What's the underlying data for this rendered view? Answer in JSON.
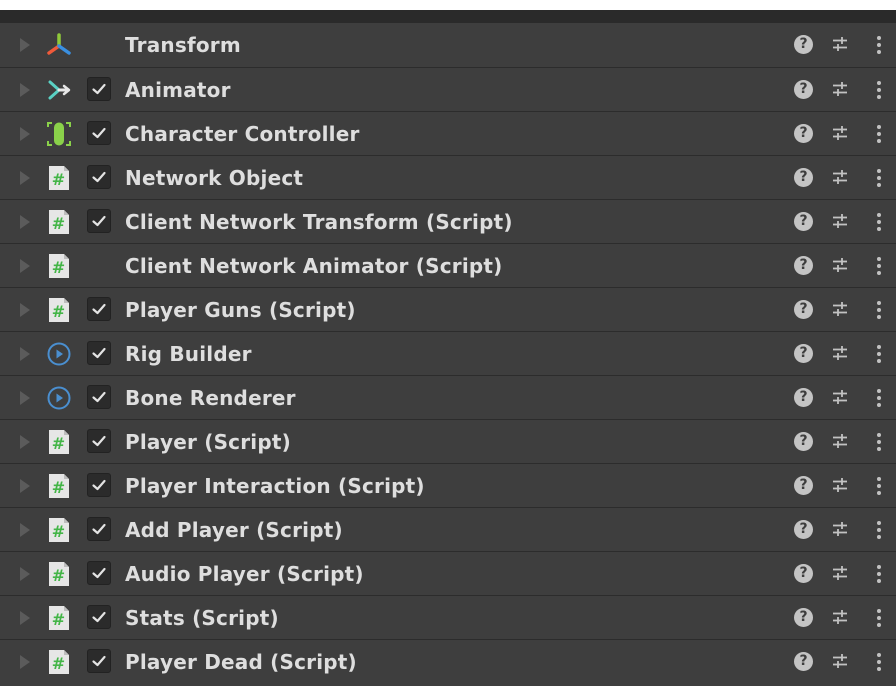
{
  "components": [
    {
      "name": "Transform",
      "icon": "transform-icon",
      "has_toggle": false
    },
    {
      "name": "Animator",
      "icon": "animator-icon",
      "has_toggle": true
    },
    {
      "name": "Character Controller",
      "icon": "character-controller-icon",
      "has_toggle": true
    },
    {
      "name": "Network Object",
      "icon": "script-icon",
      "has_toggle": true
    },
    {
      "name": "Client Network Transform (Script)",
      "icon": "script-icon",
      "has_toggle": true
    },
    {
      "name": "Client Network Animator (Script)",
      "icon": "script-icon",
      "has_toggle": false
    },
    {
      "name": "Player Guns (Script)",
      "icon": "script-icon",
      "has_toggle": true
    },
    {
      "name": "Rig Builder",
      "icon": "rig-icon",
      "has_toggle": true
    },
    {
      "name": "Bone Renderer",
      "icon": "rig-icon",
      "has_toggle": true
    },
    {
      "name": "Player (Script)",
      "icon": "script-icon",
      "has_toggle": true
    },
    {
      "name": "Player Interaction (Script)",
      "icon": "script-icon",
      "has_toggle": true
    },
    {
      "name": "Add Player (Script)",
      "icon": "script-icon",
      "has_toggle": true
    },
    {
      "name": "Audio Player (Script)",
      "icon": "script-icon",
      "has_toggle": true
    },
    {
      "name": "Stats (Script)",
      "icon": "script-icon",
      "has_toggle": true
    },
    {
      "name": "Player Dead (Script)",
      "icon": "script-icon",
      "has_toggle": true
    }
  ],
  "help_glyph": "?",
  "colors": {
    "panel_bg": "#383838",
    "row_bg": "#3e3e3e",
    "label": "#dedede",
    "script_green": "#7ed957",
    "rig_blue": "#4a8fd0"
  }
}
